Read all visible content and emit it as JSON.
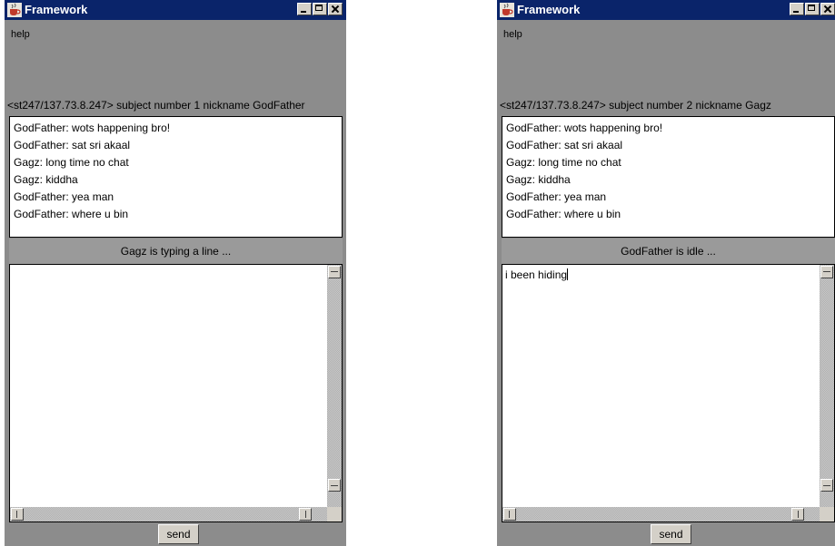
{
  "windows": [
    {
      "title": "Framework",
      "menu": [
        "help"
      ],
      "subject_line": "<st247/137.73.8.247> subject number 1 nickname GodFather",
      "chat_lines": [
        "GodFather: wots happening bro!",
        "GodFather: sat sri akaal",
        "Gagz: long time no chat",
        "Gagz: kiddha",
        "GodFather: yea man",
        "GodFather: where u bin"
      ],
      "status": "Gagz is typing a line ...",
      "input_value": "",
      "send_label": "send"
    },
    {
      "title": "Framework",
      "menu": [
        "help"
      ],
      "subject_line": "<st247/137.73.8.247> subject number 2 nickname Gagz",
      "chat_lines": [
        "GodFather: wots happening bro!",
        "GodFather: sat sri akaal",
        "Gagz: long time no chat",
        "Gagz: kiddha",
        "GodFather: yea man",
        "GodFather: where u bin"
      ],
      "status": "GodFather is idle ...",
      "input_value": "i been hiding",
      "send_label": "send"
    }
  ],
  "colors": {
    "titlebar": "#0a246a",
    "window_bg": "#8c8c8c",
    "status_bg": "#9a9a9a",
    "button_face": "#d4d0c8"
  },
  "icons": [
    "java-cup-icon",
    "minimize-icon",
    "maximize-icon",
    "close-icon"
  ]
}
